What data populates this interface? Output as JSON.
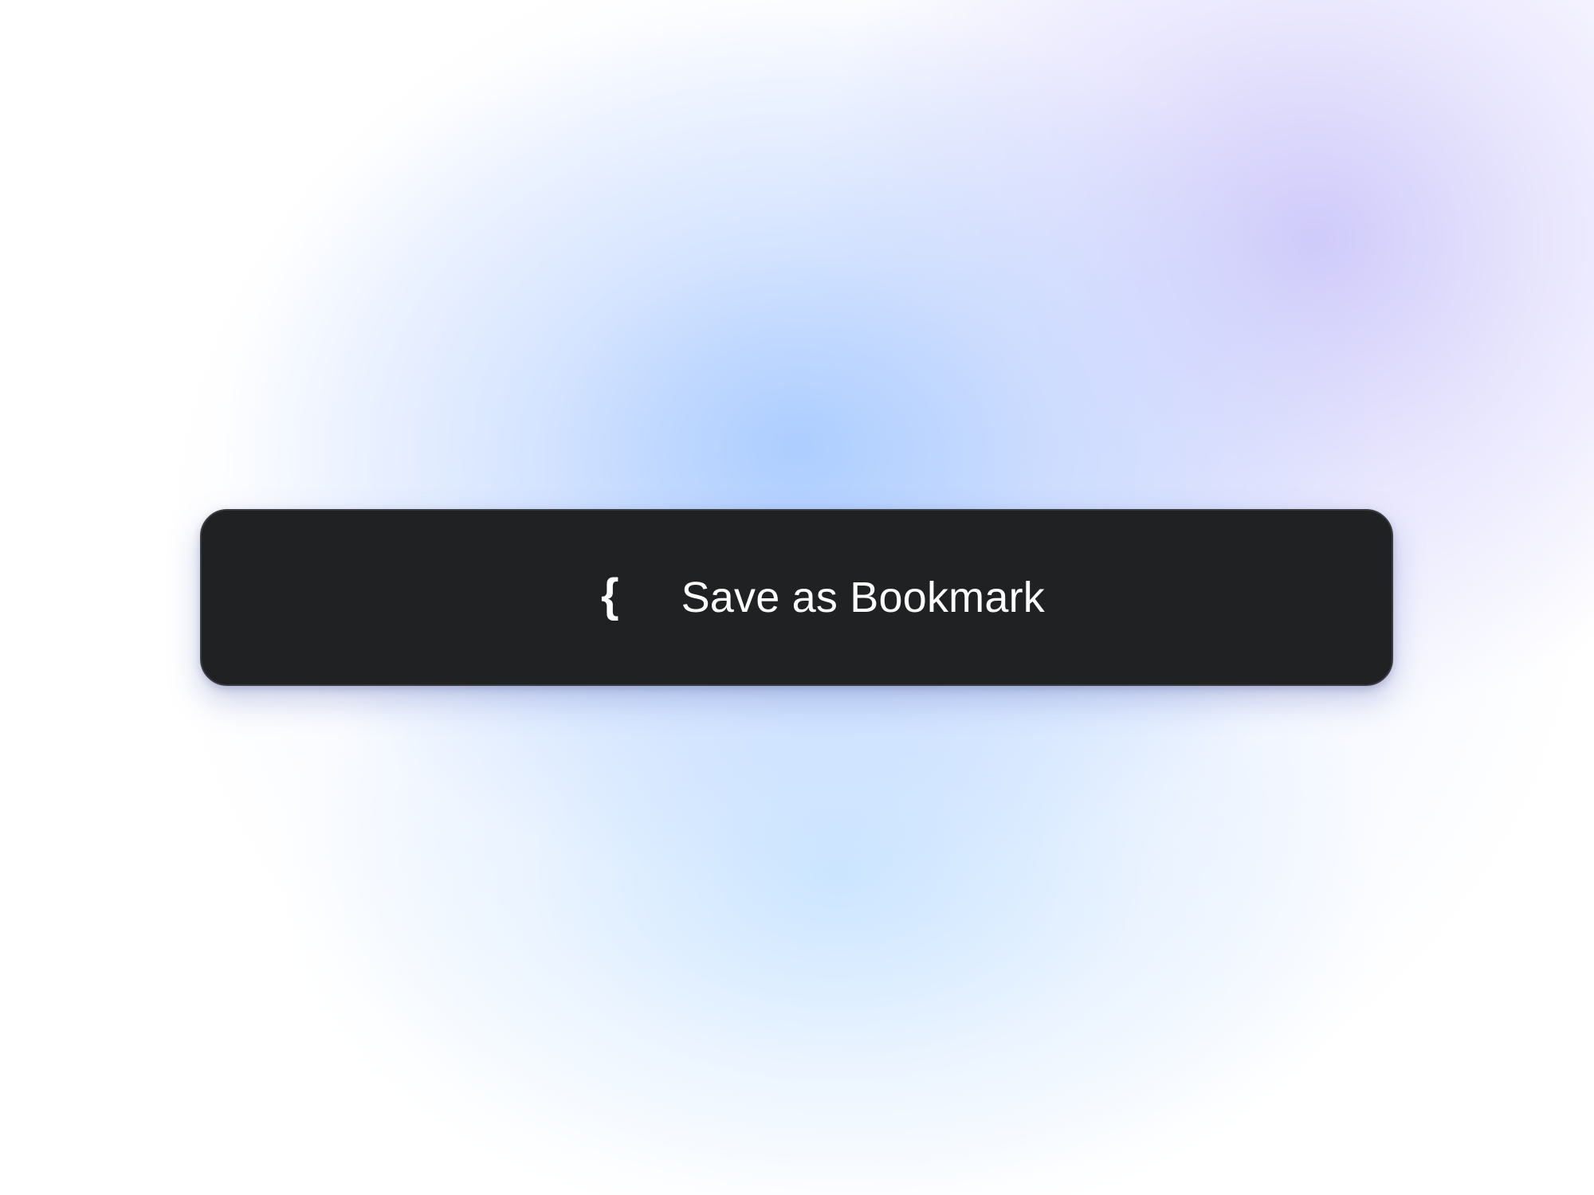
{
  "bookmark_button": {
    "label": "Save as Bookmark",
    "icon_name": "curly-brace-icon",
    "icon_glyph": "{"
  },
  "colors": {
    "button_background": "#202123",
    "button_text": "#ffffff"
  }
}
